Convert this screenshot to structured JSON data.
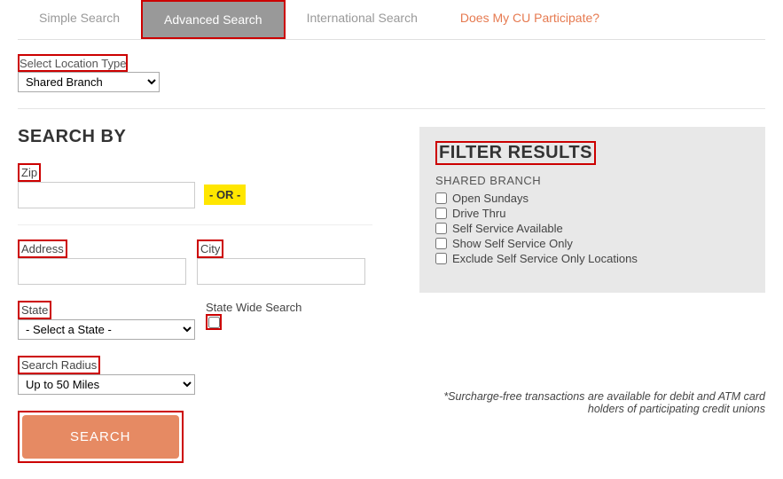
{
  "tabs": {
    "simple": "Simple Search",
    "advanced": "Advanced Search",
    "international": "International Search",
    "participate": "Does My CU Participate?"
  },
  "location_type": {
    "label": "Select Location Type",
    "selected": "Shared Branch"
  },
  "search_by": {
    "heading": "SEARCH BY",
    "zip_label": "Zip",
    "or": "- OR -",
    "address_label": "Address",
    "city_label": "City",
    "state_label": "State",
    "state_selected": "- Select a State -",
    "state_wide_label": "State Wide Search",
    "radius_label": "Search Radius",
    "radius_selected": "Up to 50 Miles",
    "search_button": "SEARCH"
  },
  "filter": {
    "heading": "FILTER RESULTS",
    "subheading": "SHARED BRANCH",
    "options": [
      "Open Sundays",
      "Drive Thru",
      "Self Service Available",
      "Show Self Service Only",
      "Exclude Self Service Only Locations"
    ]
  },
  "footnote": "*Surcharge-free transactions are available for debit and ATM card holders of participating credit unions"
}
